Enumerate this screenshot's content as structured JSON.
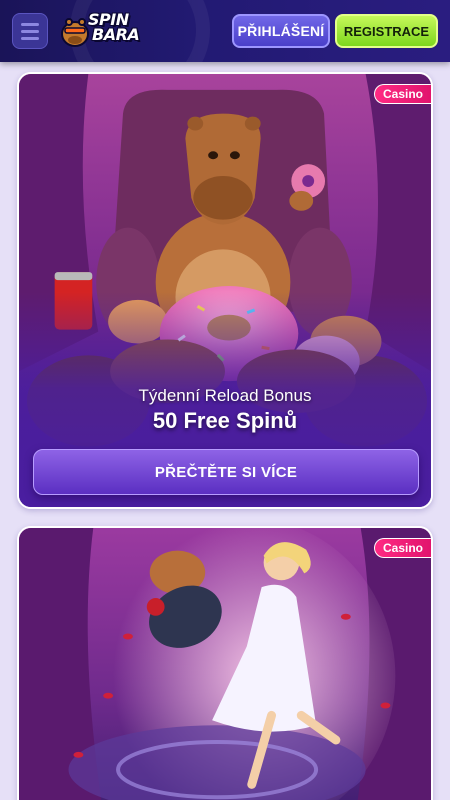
{
  "header": {
    "logo_line1": "SPIN",
    "logo_line2": "BARA",
    "login_label": "PŘIHLÁŠENÍ",
    "register_label": "REGISTRACE"
  },
  "promos": [
    {
      "badge": "Casino",
      "subtitle": "Týdenní Reload Bonus",
      "title": "50 Free Spinů",
      "cta": "PŘEČTĚTE SI VÍCE"
    },
    {
      "badge": "Casino"
    }
  ]
}
